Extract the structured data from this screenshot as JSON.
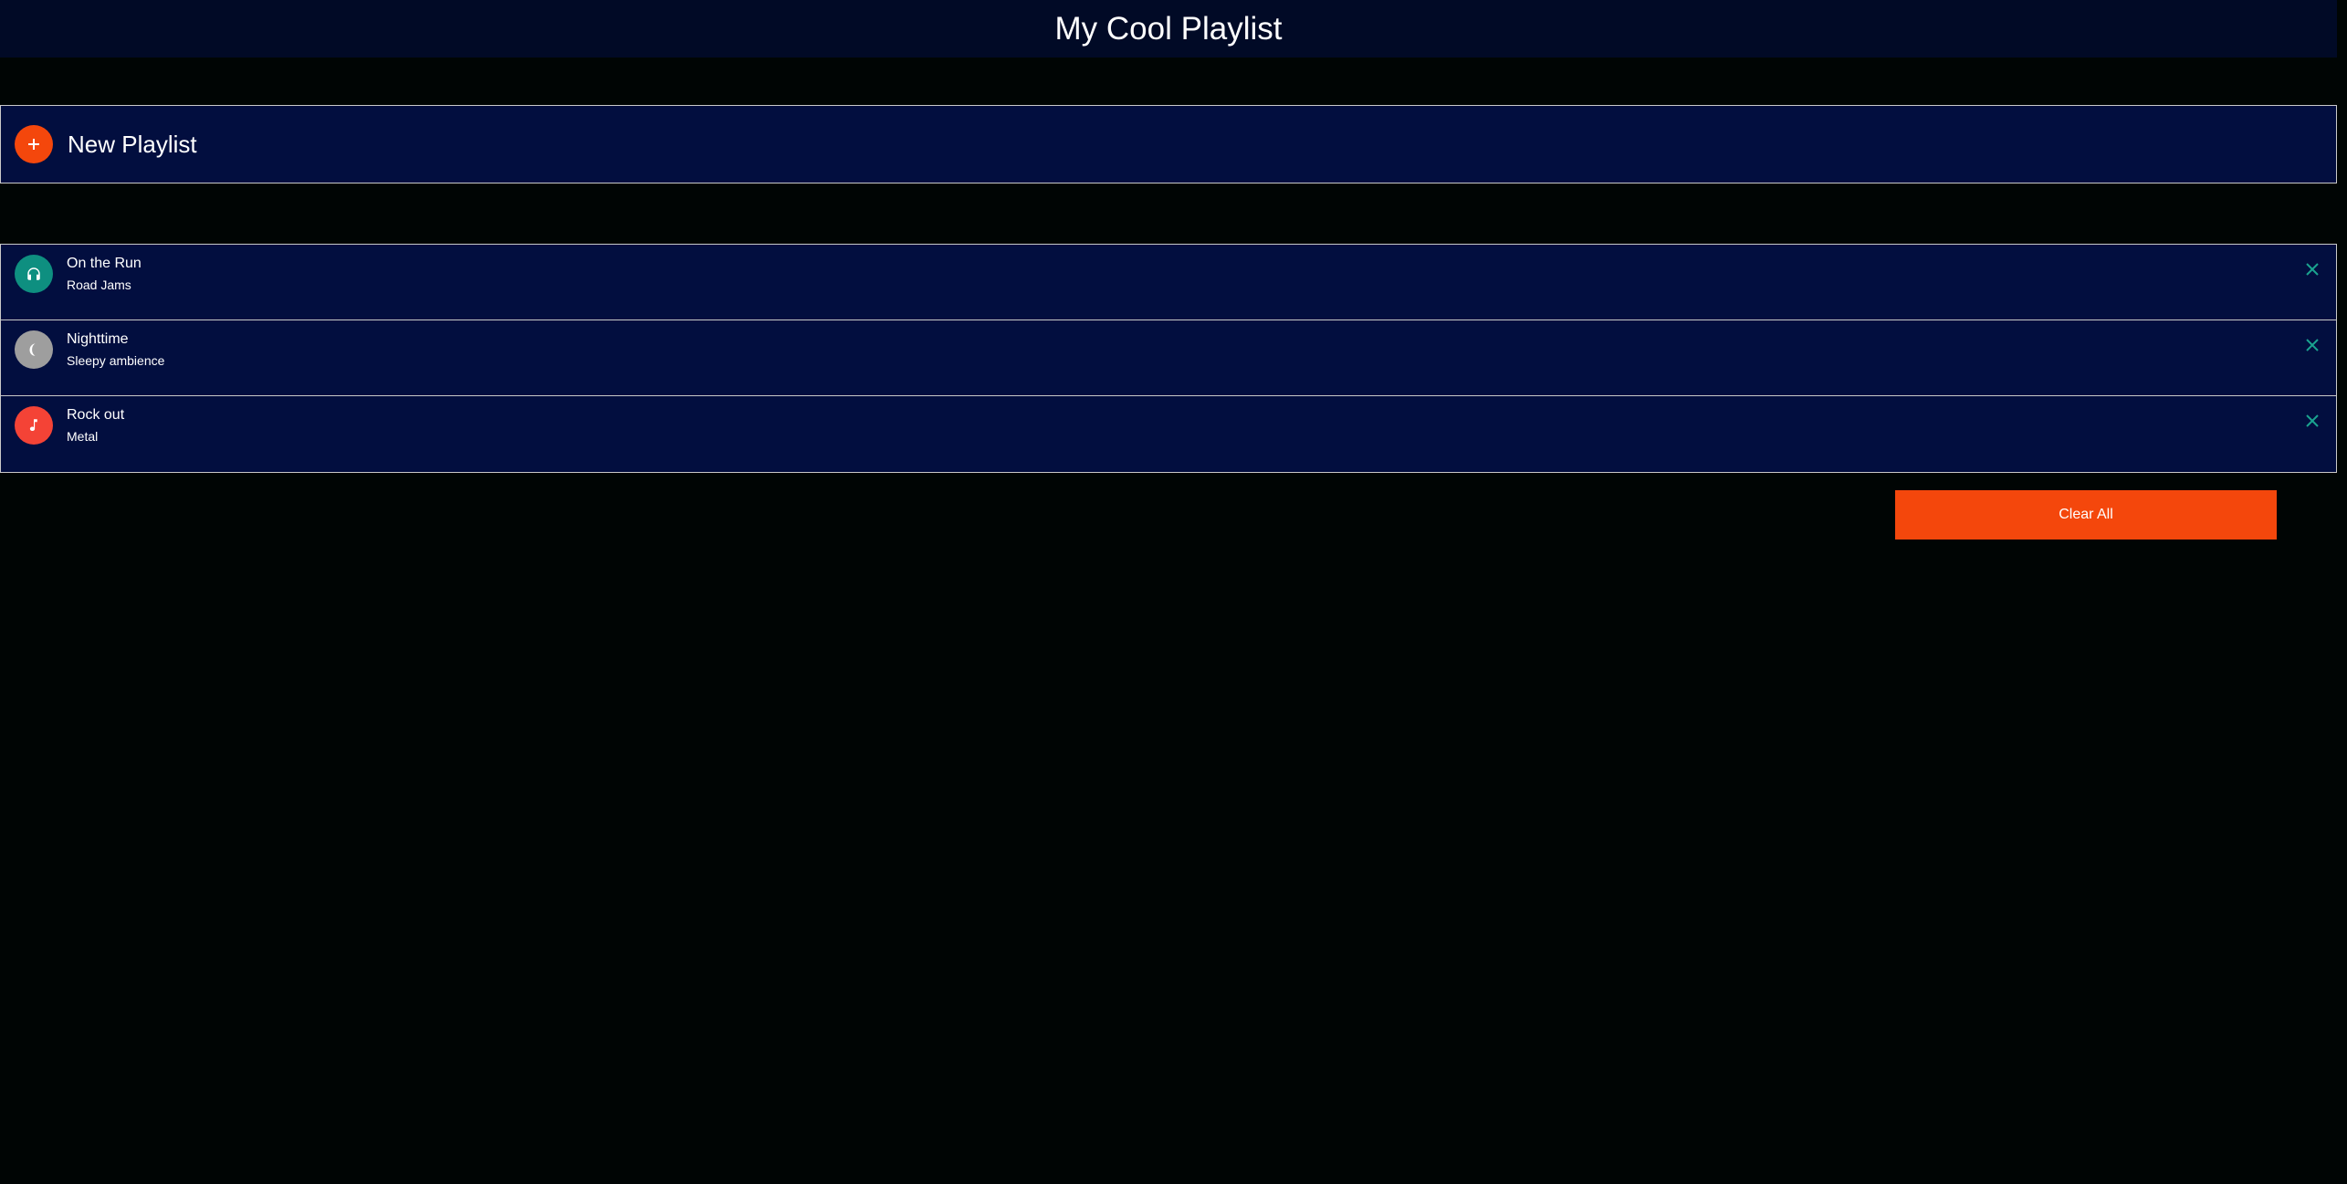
{
  "header": {
    "title": "My Cool Playlist"
  },
  "new_playlist": {
    "label": "New Playlist",
    "icon": "plus-icon",
    "icon_bg": "#f4470c"
  },
  "playlists": [
    {
      "title": "On the Run",
      "subtitle": "Road Jams",
      "icon": "headphones-icon",
      "icon_bg": "#0e8f80"
    },
    {
      "title": "Nighttime",
      "subtitle": "Sleepy ambience",
      "icon": "moon-icon",
      "icon_bg": "#9e9e9e"
    },
    {
      "title": "Rock out",
      "subtitle": "Metal",
      "icon": "music-note-icon",
      "icon_bg": "#f44336"
    }
  ],
  "close_icon": "close-icon",
  "close_color": "#1aa38f",
  "clear_all_label": "Clear All",
  "accent": "#f4470c",
  "panel_bg": "#020e3f",
  "header_bg": "#010a26",
  "page_bg": "#000504"
}
